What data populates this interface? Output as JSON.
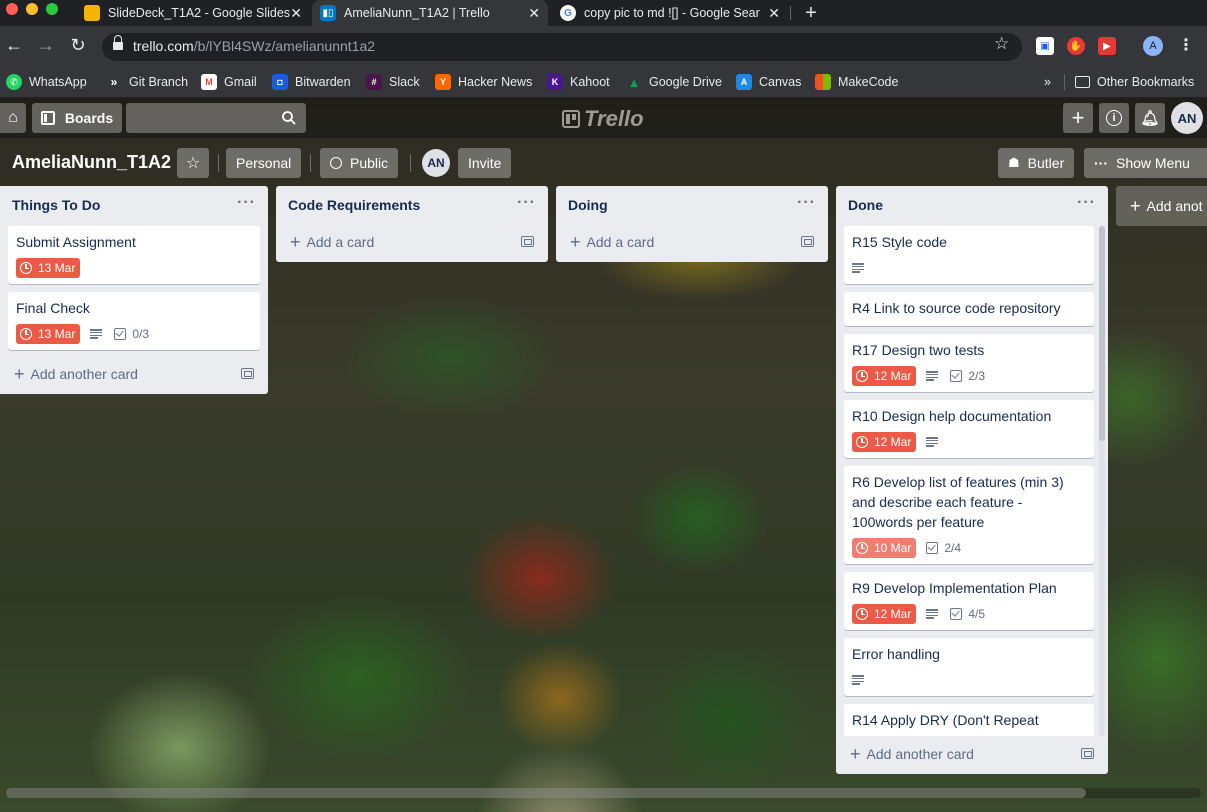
{
  "browser": {
    "tabs": [
      {
        "title": "SlideDeck_T1A2 - Google Slides",
        "favicon": "slides-icon",
        "color": "#f4b400"
      },
      {
        "title": "AmeliaNunn_T1A2 | Trello",
        "favicon": "trello-icon",
        "color": "#0079bf"
      },
      {
        "title": "copy pic to md ![] - Google Search",
        "favicon": "google-icon",
        "color": "#4285f4"
      }
    ],
    "url_host": "trello.com",
    "url_path": "/b/lYBl4SWz/amelianunnt1a2",
    "profile_initial": "A",
    "bookmarks": [
      {
        "label": "WhatsApp",
        "icon": "whatsapp-icon",
        "color": "#25d366"
      },
      {
        "label": "Git Branch",
        "icon": "git-icon",
        "color": "#5f6368"
      },
      {
        "label": "Gmail",
        "icon": "gmail-icon",
        "color": "#ea4335"
      },
      {
        "label": "Bitwarden",
        "icon": "bitwarden-icon",
        "color": "#175ddc"
      },
      {
        "label": "Slack",
        "icon": "slack-icon",
        "color": "#4a154b"
      },
      {
        "label": "Hacker News",
        "icon": "hackernews-icon",
        "color": "#ff6600"
      },
      {
        "label": "Kahoot",
        "icon": "kahoot-icon",
        "color": "#46178f"
      },
      {
        "label": "Google Drive",
        "icon": "drive-icon",
        "color": "#0f9d58"
      },
      {
        "label": "Canvas",
        "icon": "canvas-icon",
        "color": "#1e88e5"
      },
      {
        "label": "MakeCode",
        "icon": "makecode-icon",
        "color": "#f25022"
      }
    ],
    "overflow": "»",
    "other_bookmarks": "Other Bookmarks"
  },
  "trello": {
    "header": {
      "boards_label": "Boards",
      "logo_text": "Trello",
      "user_initials": "AN"
    },
    "board": {
      "title": "AmeliaNunn_T1A2",
      "visibility_team": "Personal",
      "visibility": "Public",
      "member_initials": "AN",
      "invite_label": "Invite",
      "butler_label": "Butler",
      "menu_label": "Show Menu",
      "add_list_label": "Add anot"
    },
    "lists": [
      {
        "name": "Things To Do",
        "cards": [
          {
            "title": "Submit Assignment",
            "due": "13 Mar"
          },
          {
            "title": "Final Check",
            "due": "13 Mar",
            "checklist": "0/3"
          }
        ],
        "add_label": "Add another card"
      },
      {
        "name": "Code Requirements",
        "add_label": "Add a card"
      },
      {
        "name": "Doing",
        "add_label": "Add a card"
      },
      {
        "name": "Done",
        "cards": [
          {
            "title": "R15 Style code"
          },
          {
            "title": "R4 Link to source code repository"
          },
          {
            "title": "R17 Design two tests",
            "due": "12 Mar",
            "checklist": "2/3"
          },
          {
            "title": "R10 Design help documentation",
            "due": "12 Mar"
          },
          {
            "title": "R6 Develop list of features (min 3) and describe each feature - 100words per feature",
            "due": "10 Mar",
            "checklist": "2/4"
          },
          {
            "title": "R9 Develop Implementation Plan",
            "due": "12 Mar",
            "checklist": "4/5"
          },
          {
            "title": "Error handling"
          },
          {
            "title": "R14 Apply DRY (Don't Repeat"
          }
        ],
        "add_label": "Add another card"
      }
    ],
    "colors": {
      "due": "#eb5a46",
      "list_bg": "#ebecf0"
    }
  }
}
